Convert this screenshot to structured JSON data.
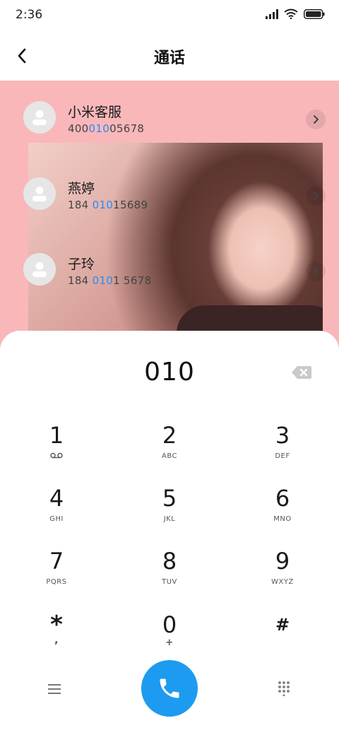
{
  "status_bar": {
    "time": "2:36"
  },
  "header": {
    "title": "通话"
  },
  "contacts": [
    {
      "name": "小米客服",
      "number_pre": "400",
      "number_hl": "010",
      "number_post": "05678"
    },
    {
      "name": "燕婷",
      "number_pre": "184 ",
      "number_hl": "010",
      "number_post": "15689"
    },
    {
      "name": "子玲",
      "number_pre": "184 ",
      "number_hl": "010",
      "number_post": "1 5678"
    }
  ],
  "dialpad": {
    "entry": "010",
    "keys": [
      {
        "digit": "1",
        "letters": "⌁"
      },
      {
        "digit": "2",
        "letters": "ABC"
      },
      {
        "digit": "3",
        "letters": "DEF"
      },
      {
        "digit": "4",
        "letters": "GHI"
      },
      {
        "digit": "5",
        "letters": "JKL"
      },
      {
        "digit": "6",
        "letters": "MNO"
      },
      {
        "digit": "7",
        "letters": "PQRS"
      },
      {
        "digit": "8",
        "letters": "TUV"
      },
      {
        "digit": "9",
        "letters": "WXYZ"
      },
      {
        "digit": "*",
        "letters": ","
      },
      {
        "digit": "0",
        "letters": "+"
      },
      {
        "digit": "#",
        "letters": ""
      }
    ]
  },
  "colors": {
    "accent": "#1d9bf0",
    "highlight": "#2a8bf2",
    "results_bg": "#f9b7b9"
  },
  "icons": {
    "back": "chevron-left-icon",
    "backspace": "backspace-icon",
    "call": "phone-icon",
    "menu": "menu-icon",
    "dialpad_toggle": "dialpad-grid-icon"
  }
}
